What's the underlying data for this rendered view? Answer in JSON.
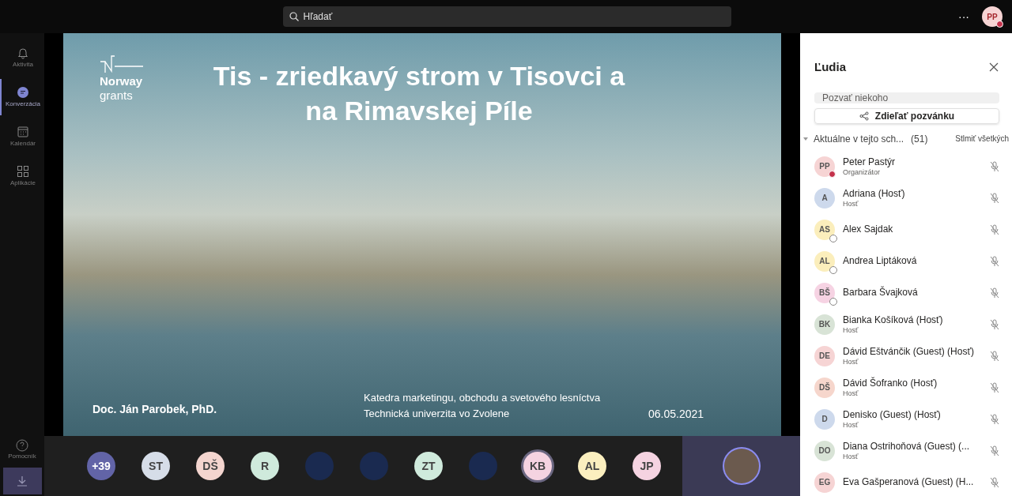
{
  "search": {
    "placeholder": "Hľadať"
  },
  "top_bar": {
    "more": "···",
    "avatar": {
      "initials": "PP",
      "busy": true
    }
  },
  "sidebar": {
    "items": [
      {
        "label": "Aktivita",
        "selected": false
      },
      {
        "label": "Konverzácia",
        "selected": true
      },
      {
        "label": "Kalendár",
        "selected": false
      },
      {
        "label": "Aplikácie",
        "selected": false
      }
    ],
    "help": {
      "label": "Pomocník"
    }
  },
  "slide": {
    "logo": {
      "line_1": "Norway",
      "line_2": "grants"
    },
    "title_lines": [
      "Tis - zriedkavý strom v Tisovci a",
      "na Rimavskej Píle"
    ],
    "author": "Doc. Ján Parobek, PhD.",
    "department_lines": [
      "Katedra marketingu, obchodu a svetového lesníctva",
      "Technická univerzita vo Zvolene"
    ],
    "date": "06.05.2021"
  },
  "participants_bar": [
    {
      "kind": "count",
      "text": "+39",
      "color": "#6264a7",
      "selected": false
    },
    {
      "kind": "initials",
      "text": "ST",
      "color": "#d6dde8",
      "selected": false
    },
    {
      "kind": "initials",
      "text": "DŠ",
      "color": "#f4d5cf",
      "selected": false
    },
    {
      "kind": "initials",
      "text": "R",
      "color": "#cfeadc",
      "selected": false
    },
    {
      "kind": "photo",
      "selected": false
    },
    {
      "kind": "photo",
      "selected": false
    },
    {
      "kind": "initials",
      "text": "ZT",
      "color": "#cfeadc",
      "selected": false
    },
    {
      "kind": "photo",
      "selected": false
    },
    {
      "kind": "initials",
      "text": "KB",
      "color": "#f5d3e1",
      "selected": true
    },
    {
      "kind": "initials",
      "text": "AL",
      "color": "#fbefbf",
      "selected": false
    },
    {
      "kind": "initials",
      "text": "JP",
      "color": "#f5d3e1",
      "selected": false
    }
  ],
  "people_panel": {
    "title": "Ľudia",
    "invite": {
      "placeholder": "Pozvať niekoho"
    },
    "share_button": "Zdieľať pozvánku",
    "section": {
      "label": "Aktuálne v tejto sch...",
      "count": "(51)",
      "expanded": true,
      "mute_all": "Stlmiť všetkých"
    },
    "people": [
      {
        "initials": "PP",
        "color": "#f6d4d4",
        "name": "Peter Pastýr",
        "role": "Organizátor",
        "busy": true,
        "away": false
      },
      {
        "initials": "A",
        "color": "#cdd9ec",
        "name": "Adriana (Hosť)",
        "role": "Hosť",
        "busy": false,
        "away": false
      },
      {
        "initials": "AS",
        "color": "#fbeebc",
        "name": "Alex Sajdak",
        "busy": false,
        "away": true
      },
      {
        "initials": "AL",
        "color": "#fbeebc",
        "name": "Andrea Liptáková",
        "busy": false,
        "away": true
      },
      {
        "initials": "BŠ",
        "color": "#f6d3e3",
        "name": "Barbara Švajková",
        "busy": false,
        "away": true
      },
      {
        "initials": "BK",
        "color": "#d8e3d6",
        "name": "Bianka Košíková (Hosť)",
        "role": "Hosť",
        "busy": false,
        "away": false
      },
      {
        "initials": "DE",
        "color": "#f6d4d4",
        "name": "Dávid Eštvánčik (Guest) (Hosť)",
        "role": "Hosť",
        "busy": false,
        "away": false
      },
      {
        "initials": "DŠ",
        "color": "#f6d6cc",
        "name": "Dávid Šofranko (Hosť)",
        "role": "Hosť",
        "busy": false,
        "away": false
      },
      {
        "initials": "D",
        "color": "#cdd9ec",
        "name": "Denisko (Guest) (Hosť)",
        "role": "Hosť",
        "busy": false,
        "away": false
      },
      {
        "initials": "DO",
        "color": "#d8e3d6",
        "name": "Diana Ostrihoňová (Guest) (...",
        "role": "Hosť",
        "busy": false,
        "away": false
      },
      {
        "initials": "EG",
        "color": "#f6d4d4",
        "name": "Eva Gašperanová (Guest) (H...",
        "busy": false,
        "away": false
      }
    ]
  }
}
